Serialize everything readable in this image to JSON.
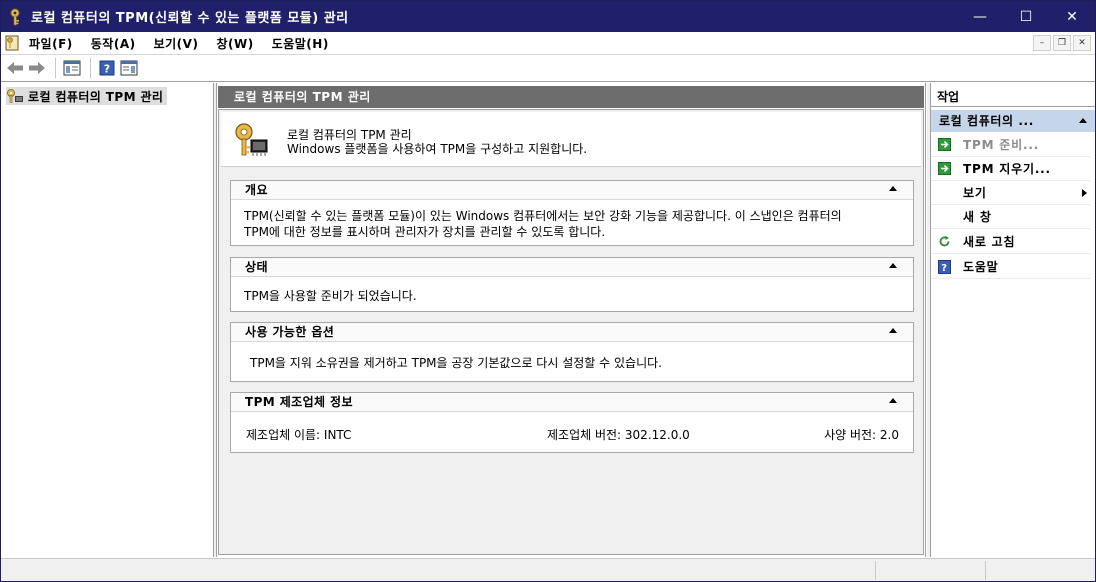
{
  "window": {
    "title": "로컬 컴퓨터의 TPM(신뢰할 수 있는 플랫폼 모듈) 관리",
    "controls": {
      "minimize": "—",
      "maximize": "☐",
      "close": "✕"
    }
  },
  "menubar": {
    "items": [
      "파일(F)",
      "동작(A)",
      "보기(V)",
      "창(W)",
      "도움말(H)"
    ],
    "mdi": {
      "minimize": "–",
      "restore": "❐",
      "close": "✕"
    }
  },
  "toolbar": {
    "icons": [
      "back-arrow-icon",
      "forward-arrow-icon",
      "show-hide-console-tree-icon",
      "help-icon",
      "show-hide-action-pane-icon"
    ]
  },
  "tree": {
    "root_label": "로컬 컴퓨터의 TPM 관리"
  },
  "center": {
    "header": "로컬 컴퓨터의 TPM 관리",
    "intro_line1": "로컬 컴퓨터의 TPM 관리",
    "intro_line2": "Windows 플랫폼을 사용하여 TPM을 구성하고 지원합니다.",
    "sections": {
      "overview": {
        "title": "개요",
        "text1": "TPM(신뢰할 수 있는 플랫폼 모듈)이 있는 Windows 컴퓨터에서는 보안 강화 기능을 제공합니다. 이 스냅인은 컴퓨터의",
        "text2": "TPM에 대한 정보를 표시하며 관리자가 장치를 관리할 수 있도록 합니다."
      },
      "status": {
        "title": "상태",
        "text": "TPM을 사용할 준비가 되었습니다."
      },
      "options": {
        "title": "사용 가능한 옵션",
        "text": "TPM을 지워 소유권을 제거하고 TPM을 공장 기본값으로 다시 설정할 수 있습니다."
      },
      "vendor": {
        "title": "TPM 제조업체 정보",
        "name": "제조업체 이름: INTC",
        "version": "제조업체 버전: 302.12.0.0",
        "spec": "사양 버전: 2.0"
      }
    }
  },
  "actions": {
    "title": "작업",
    "group": "로컬 컴퓨터의 ...",
    "items": [
      {
        "label": "TPM 준비...",
        "icon": "green-arrow-icon",
        "disabled": true
      },
      {
        "label": "TPM 지우기...",
        "icon": "green-arrow-icon",
        "disabled": false
      },
      {
        "label": "보기",
        "icon": "",
        "disabled": false
      },
      {
        "label": "새 창",
        "icon": "",
        "disabled": false
      },
      {
        "label": "새로 고침",
        "icon": "refresh-icon",
        "disabled": false
      },
      {
        "label": "도움말",
        "icon": "help-icon",
        "disabled": false
      }
    ]
  },
  "colors": {
    "titlebar": "#1f1f6a",
    "center_header": "#6d6d6d",
    "actions_group": "#c5d5ea",
    "disabled_text": "#8c8c8c"
  }
}
